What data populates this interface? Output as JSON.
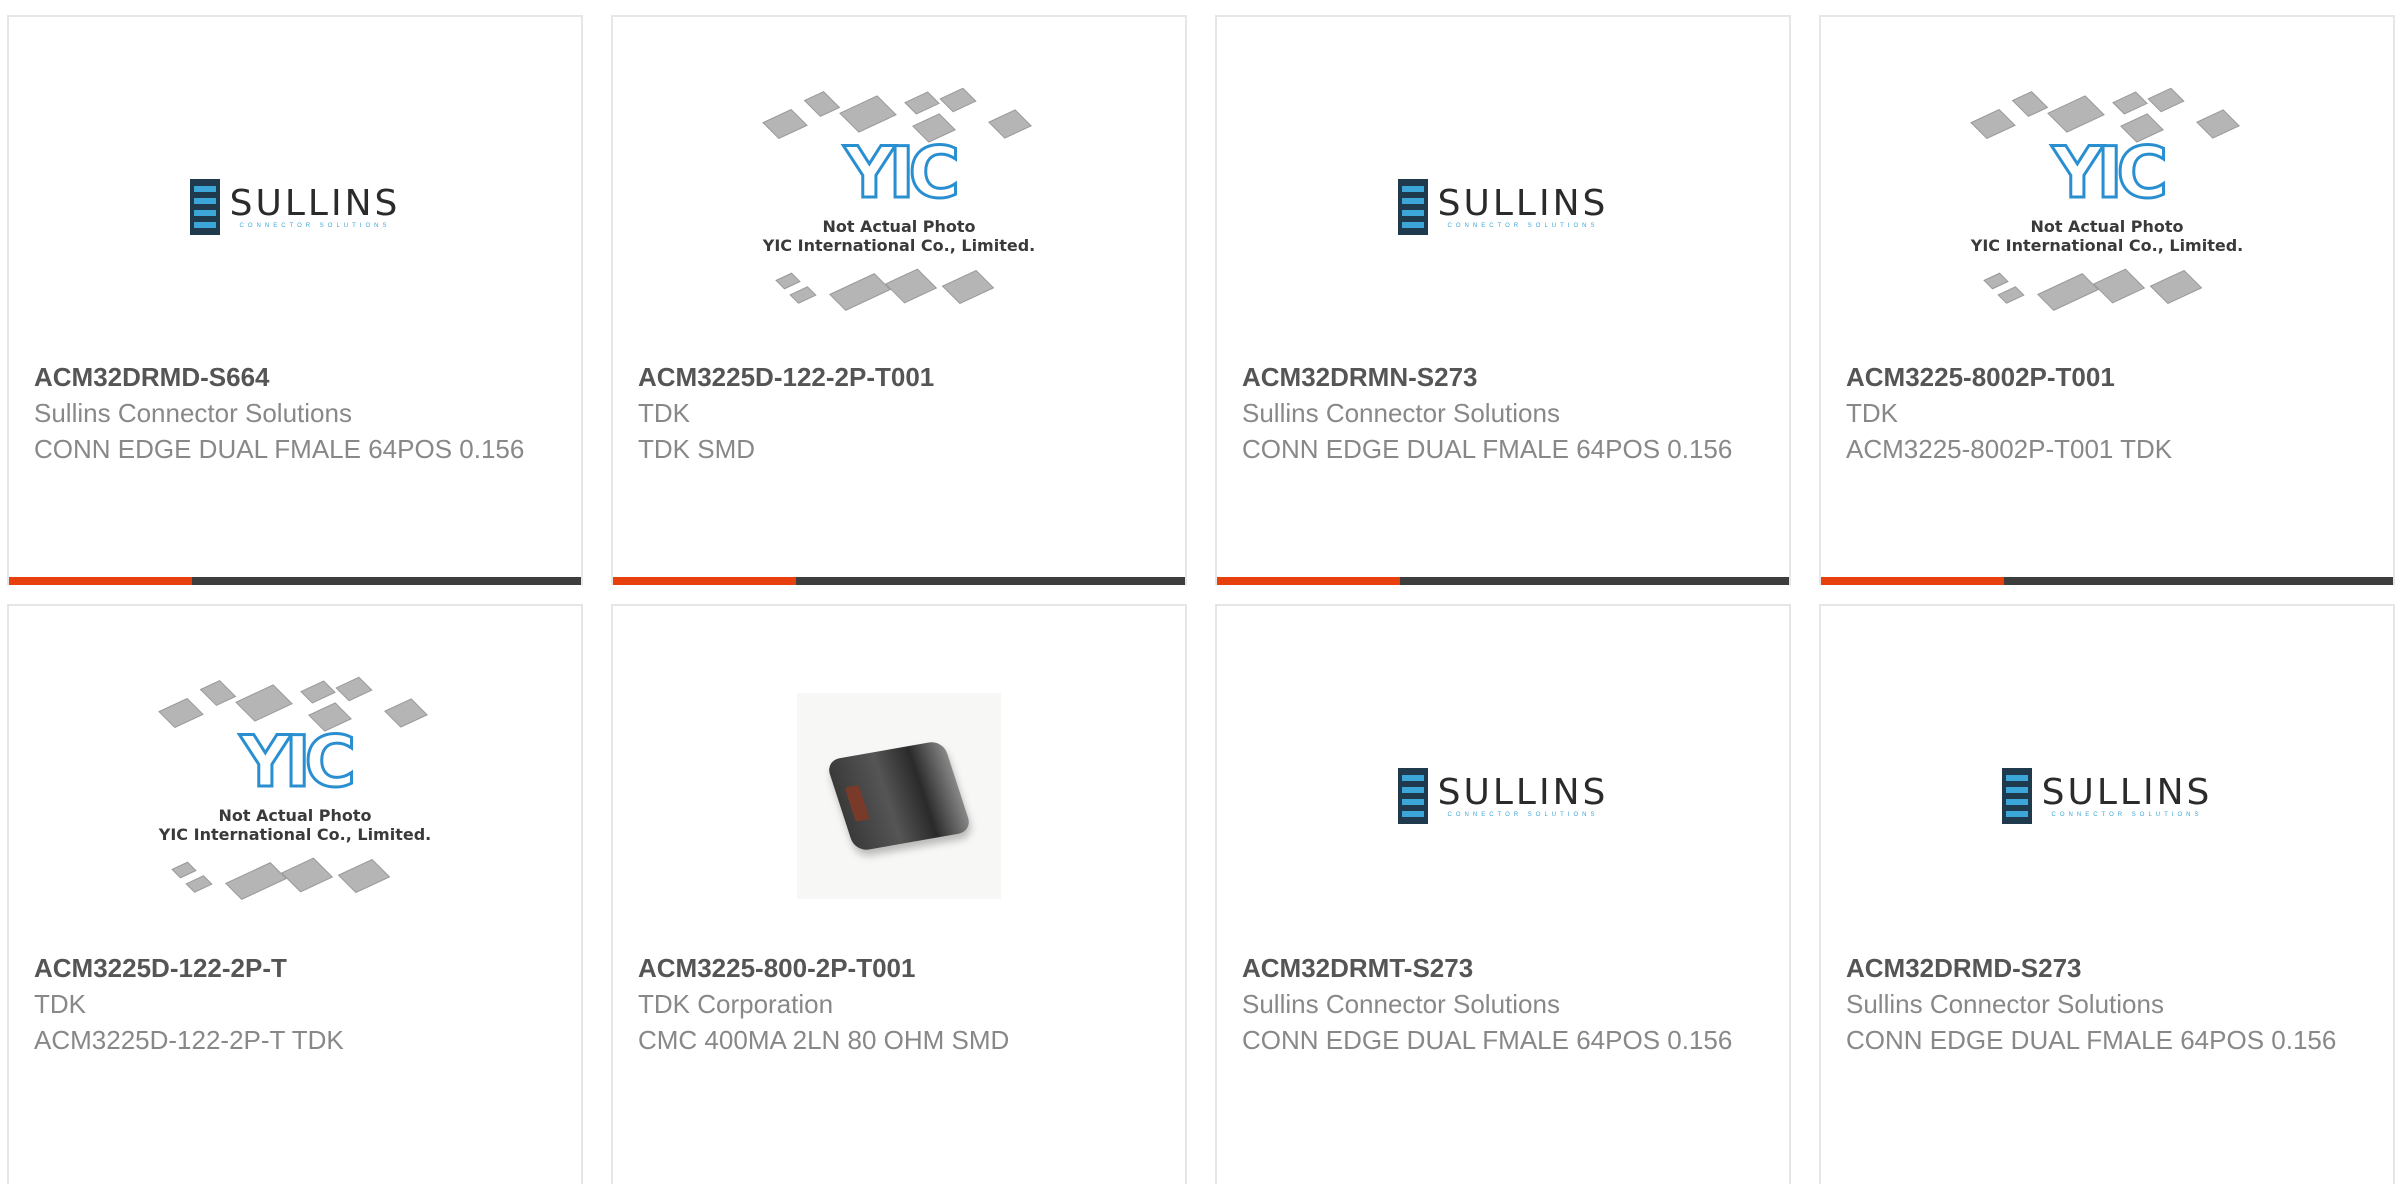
{
  "cards": [
    {
      "part": "ACM32DRMD-S664",
      "manufacturer": "Sullins Connector Solutions",
      "description": "CONN EDGE DUAL FMALE 64POS 0.156",
      "image": "sullins-logo"
    },
    {
      "part": "ACM3225D-122-2P-T001",
      "manufacturer": "TDK",
      "description": "TDK SMD",
      "image": "yic-placeholder"
    },
    {
      "part": "ACM32DRMN-S273",
      "manufacturer": "Sullins Connector Solutions",
      "description": "CONN EDGE DUAL FMALE 64POS 0.156",
      "image": "sullins-logo"
    },
    {
      "part": "ACM3225-8002P-T001",
      "manufacturer": "TDK",
      "description": "ACM3225-8002P-T001 TDK",
      "image": "yic-placeholder"
    },
    {
      "part": "ACM3225D-122-2P-T",
      "manufacturer": "TDK",
      "description": "ACM3225D-122-2P-T TDK",
      "image": "yic-placeholder"
    },
    {
      "part": "ACM3225-800-2P-T001",
      "manufacturer": "TDK Corporation",
      "description": "CMC 400MA 2LN 80 OHM SMD",
      "image": "component-photo"
    },
    {
      "part": "ACM32DRMT-S273",
      "manufacturer": "Sullins Connector Solutions",
      "description": "CONN EDGE DUAL FMALE 64POS 0.156",
      "image": "sullins-logo"
    },
    {
      "part": "ACM32DRMD-S273",
      "manufacturer": "Sullins Connector Solutions",
      "description": "CONN EDGE DUAL FMALE 64POS 0.156",
      "image": "sullins-logo"
    }
  ],
  "logos": {
    "sullins_name": "SULLINS",
    "sullins_tag": "CONNECTOR SOLUTIONS",
    "yic_mark": "YIC",
    "yic_caption_1": "Not Actual Photo",
    "yic_caption_2": "YIC International Co., Limited."
  },
  "colors": {
    "accent": "#e8400c",
    "bar": "#3d3d3d",
    "part_text": "#555555",
    "secondary_text": "#888888",
    "border": "#e6e6e6",
    "sullins_blue": "#3ca6d8"
  }
}
